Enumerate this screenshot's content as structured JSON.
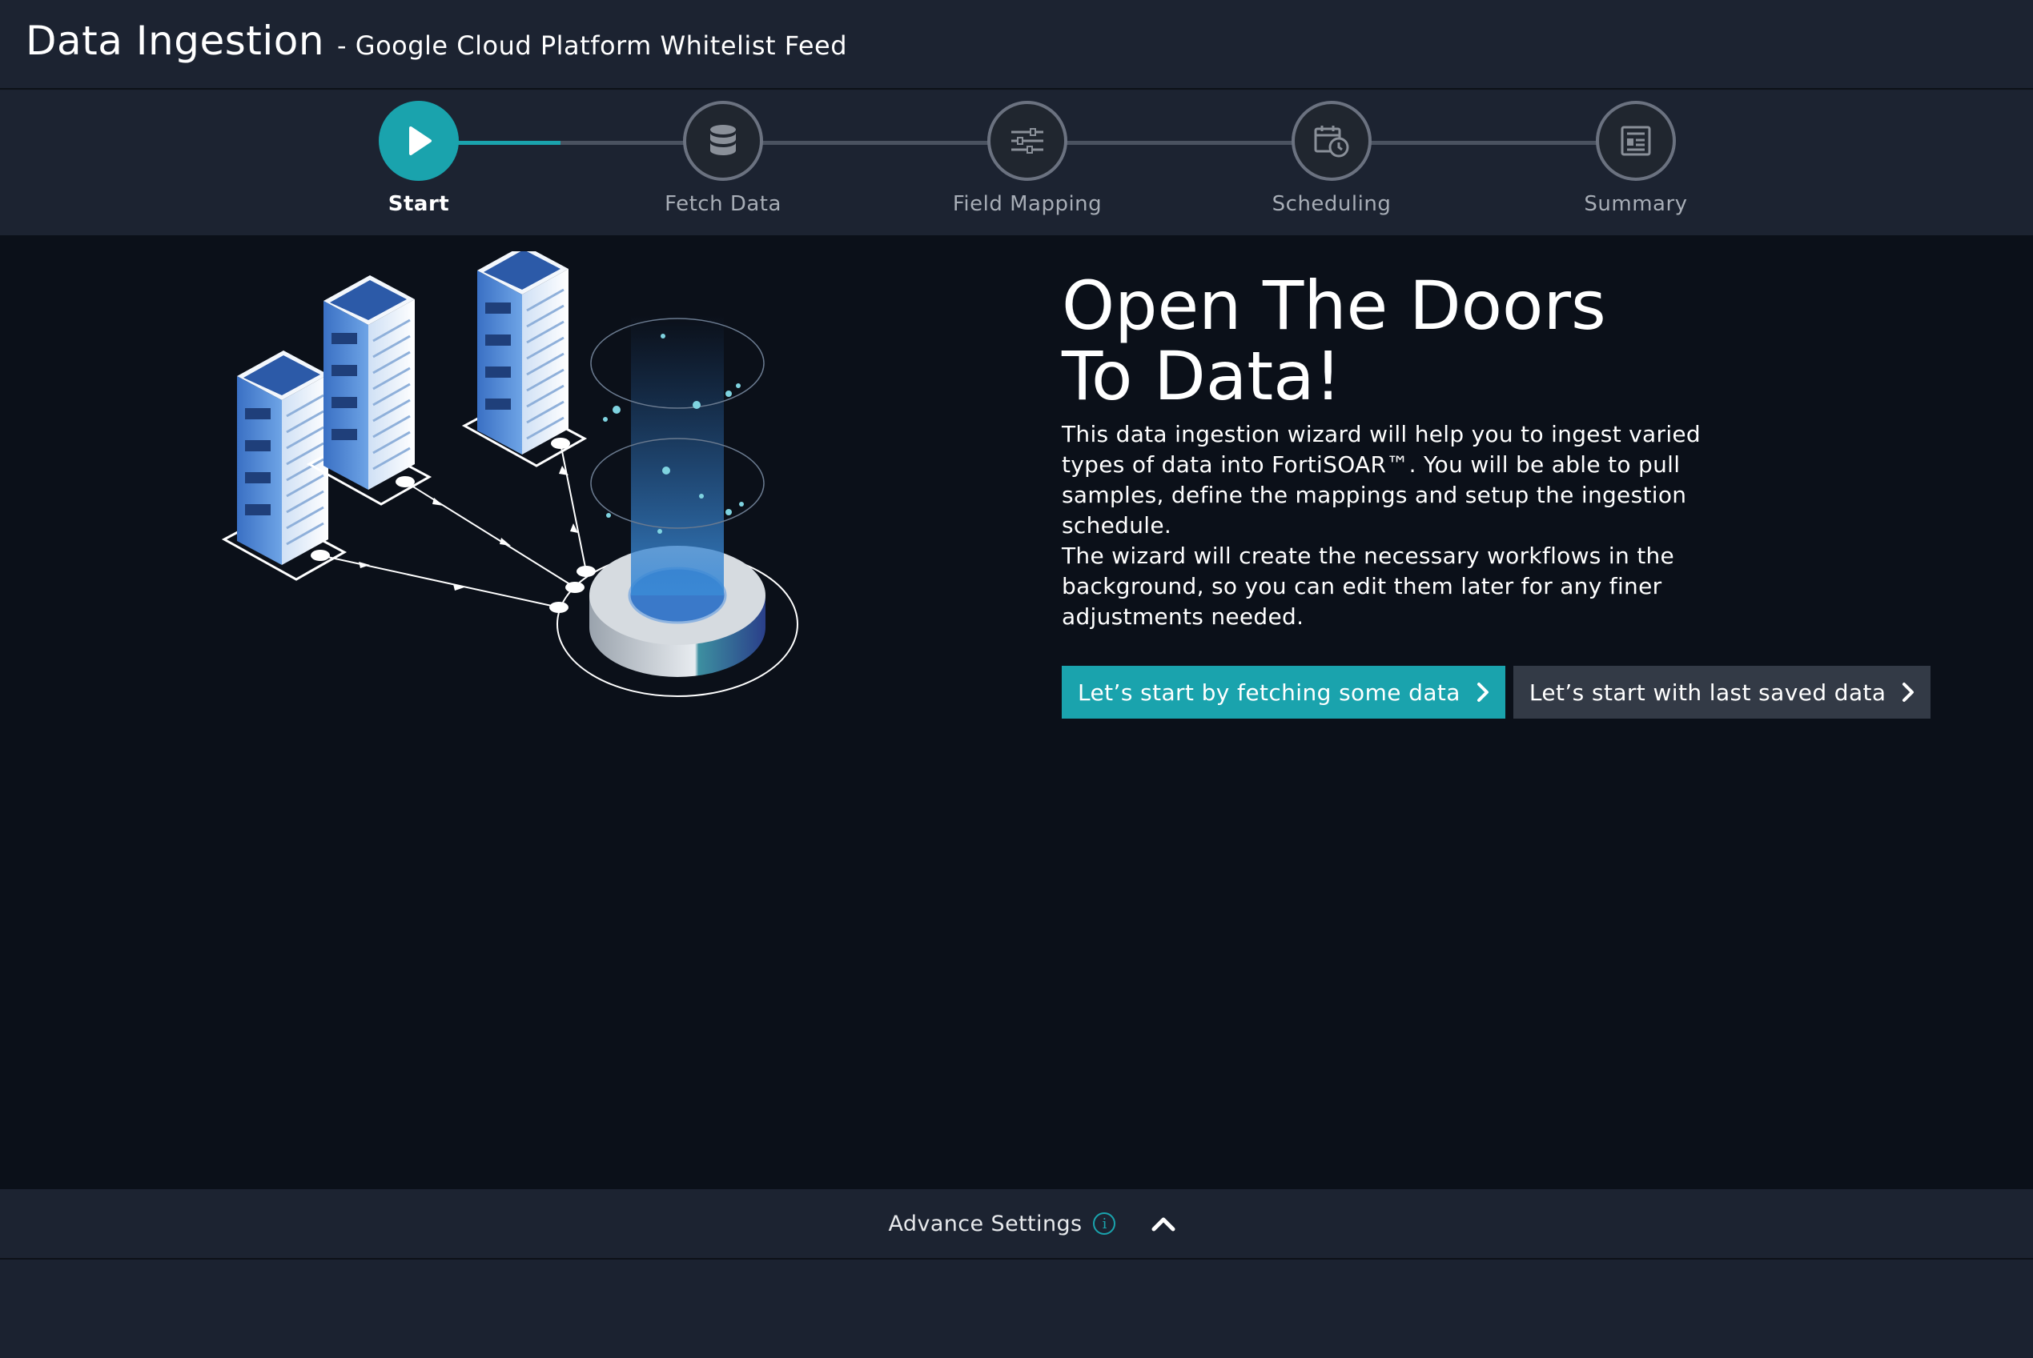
{
  "header": {
    "title": "Data Ingestion",
    "subtitle": "- Google Cloud Platform Whitelist Feed"
  },
  "stepper": {
    "steps": [
      {
        "label": "Start",
        "icon": "play-icon",
        "active": true
      },
      {
        "label": "Fetch Data",
        "icon": "database-icon",
        "active": false
      },
      {
        "label": "Field Mapping",
        "icon": "sliders-icon",
        "active": false
      },
      {
        "label": "Scheduling",
        "icon": "calendar-clock-icon",
        "active": false
      },
      {
        "label": "Summary",
        "icon": "document-icon",
        "active": false
      }
    ]
  },
  "main": {
    "headline_line1": "Open The Doors",
    "headline_line2": "To Data!",
    "description_p1": "This data ingestion wizard will help you to ingest varied types of data into FortiSOAR™. You will be able to pull samples, define the mappings and setup the ingestion schedule.",
    "description_p2": "The wizard will create the necessary workflows in the background, so you can edit them later for any finer adjustments needed.",
    "primary_button": "Let’s start by fetching some data",
    "secondary_button": "Let’s start with last saved data"
  },
  "advance_settings": {
    "label": "Advance Settings",
    "info_glyph": "i"
  },
  "colors": {
    "accent": "#1aa3ad",
    "background": "#0b1019",
    "bar": "#1c2331"
  }
}
